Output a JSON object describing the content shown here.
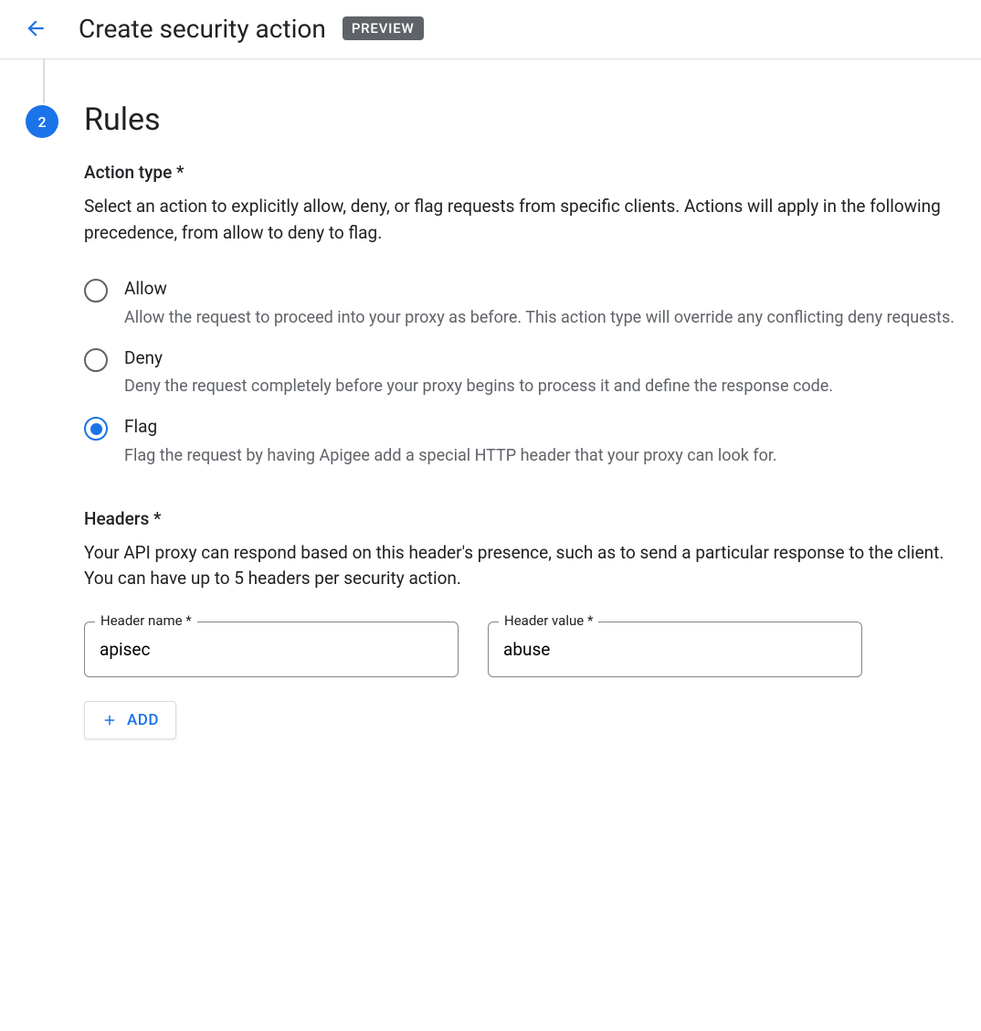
{
  "header": {
    "title": "Create security action",
    "badge": "PREVIEW"
  },
  "step": {
    "number": "2",
    "title": "Rules"
  },
  "actionType": {
    "label": "Action type *",
    "description": "Select an action to explicitly allow, deny, or flag requests from specific clients. Actions will apply in the following precedence, from allow to deny to flag.",
    "options": [
      {
        "label": "Allow",
        "desc": "Allow the request to proceed into your proxy as before. This action type will override any conflicting deny requests.",
        "selected": false
      },
      {
        "label": "Deny",
        "desc": "Deny the request completely before your proxy begins to process it and define the response code.",
        "selected": false
      },
      {
        "label": "Flag",
        "desc": "Flag the request by having Apigee add a special HTTP header that your proxy can look for.",
        "selected": true
      }
    ]
  },
  "headersSection": {
    "label": "Headers *",
    "description": "Your API proxy can respond based on this header's presence, such as to send a particular response to the client. You can have up to 5 headers per security action.",
    "fields": {
      "nameLabel": "Header name *",
      "nameValue": "apisec",
      "valueLabel": "Header value *",
      "valueValue": "abuse"
    },
    "addButton": "ADD"
  }
}
